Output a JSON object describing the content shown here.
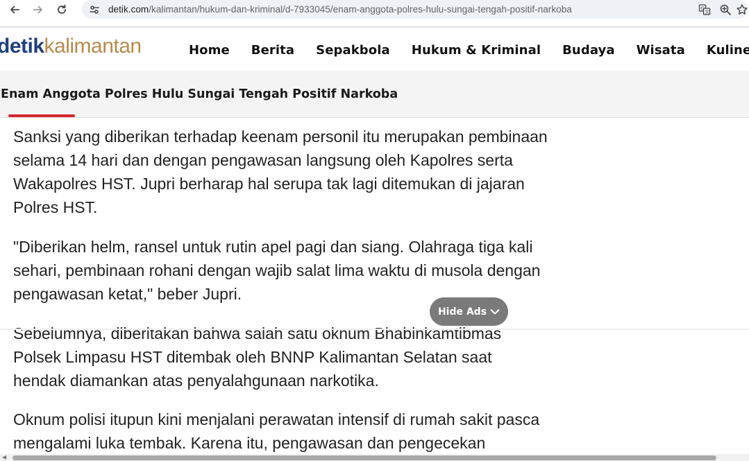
{
  "browser": {
    "url_host": "detik.com",
    "url_path": "/kalimantan/hukum-dan-kriminal/d-7933045/enam-anggota-polres-hulu-sungai-tengah-positif-narkoba",
    "icons": [
      "back-arrow-icon",
      "forward-arrow-icon",
      "reload-icon",
      "site-info-icon",
      "translate-icon",
      "zoom-icon",
      "bookmark-star-icon"
    ]
  },
  "site": {
    "logo_brand": "detik",
    "logo_region": "kalimantan",
    "brand_color": "#1e3f80",
    "region_color": "#b88a4b",
    "nav": [
      "Home",
      "Berita",
      "Sepakbola",
      "Hukum & Kriminal",
      "Budaya",
      "Wisata",
      "Kuliner"
    ]
  },
  "article": {
    "title": "Enam Anggota Polres Hulu Sungai Tengah Positif Narkoba",
    "accent_color": "#d4262e",
    "paragraphs": [
      "Sanksi yang diberikan terhadap keenam personil itu merupakan pembinaan selama 14 hari dan dengan pengawasan langsung oleh Kapolres serta Wakapolres HST. Jupri berharap hal serupa tak lagi ditemukan di jajaran Polres HST.",
      "\"Diberikan helm, ransel untuk rutin apel pagi dan siang. Olahraga tiga kali sehari, pembinaan rohani dengan wajib salat lima waktu di musola dengan pengawasan ketat,\" beber Jupri.",
      "Sebelumnya, diberitakan bahwa salah satu oknum Bhabinkamtibmas Polsek Limpasu HST ditembak oleh BNNP Kalimantan Selatan saat hendak diamankan atas penyalahgunaan narkotika.",
      "Oknum polisi itupun kini menjalani perawatan intensif di rumah sakit pasca mengalami luka tembak. Karena itu, pengawasan dan pengecekan"
    ]
  },
  "ads": {
    "hide_label": "Hide Ads"
  }
}
